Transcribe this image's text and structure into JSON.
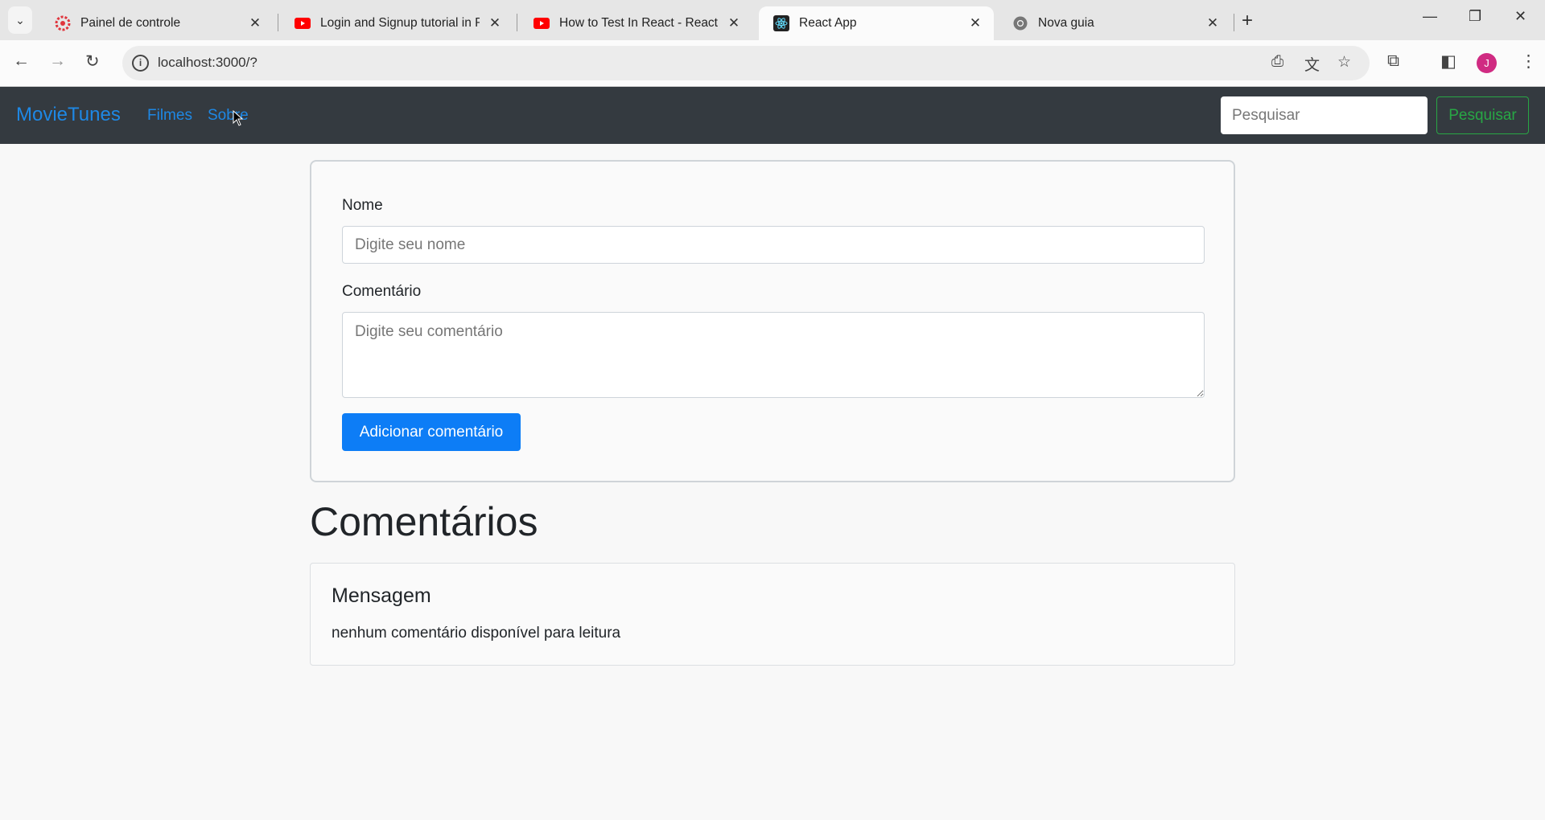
{
  "browser": {
    "tabs": [
      {
        "title": "Painel de controle",
        "icon": "gear-flower-icon",
        "active": false
      },
      {
        "title": "Login and Signup tutorial in R",
        "icon": "youtube-icon",
        "active": false
      },
      {
        "title": "How to Test In React - React Te",
        "icon": "youtube-icon",
        "active": false
      },
      {
        "title": "React App",
        "icon": "react-icon",
        "active": true
      },
      {
        "title": "Nova guia",
        "icon": "chrome-icon",
        "active": false
      }
    ],
    "url": "localhost:3000/?",
    "profile_initial": "J",
    "colors": {
      "youtube": "#ff0000",
      "profile": "#d02b82"
    }
  },
  "navbar": {
    "brand": "MovieTunes",
    "links": [
      "Filmes",
      "Sobre"
    ],
    "search_placeholder": "Pesquisar",
    "search_button": "Pesquisar",
    "colors": {
      "background": "#343a40",
      "link": "#1e88e5",
      "search_button": "#28a745"
    }
  },
  "form": {
    "name_label": "Nome",
    "name_placeholder": "Digite seu nome",
    "comment_label": "Comentário",
    "comment_placeholder": "Digite seu comentário",
    "submit_label": "Adicionar comentário",
    "colors": {
      "primary": "#0d7df6"
    }
  },
  "comments": {
    "heading": "Comentários",
    "card_title": "Mensagem",
    "card_text": "nenhum comentário disponível para leitura"
  }
}
